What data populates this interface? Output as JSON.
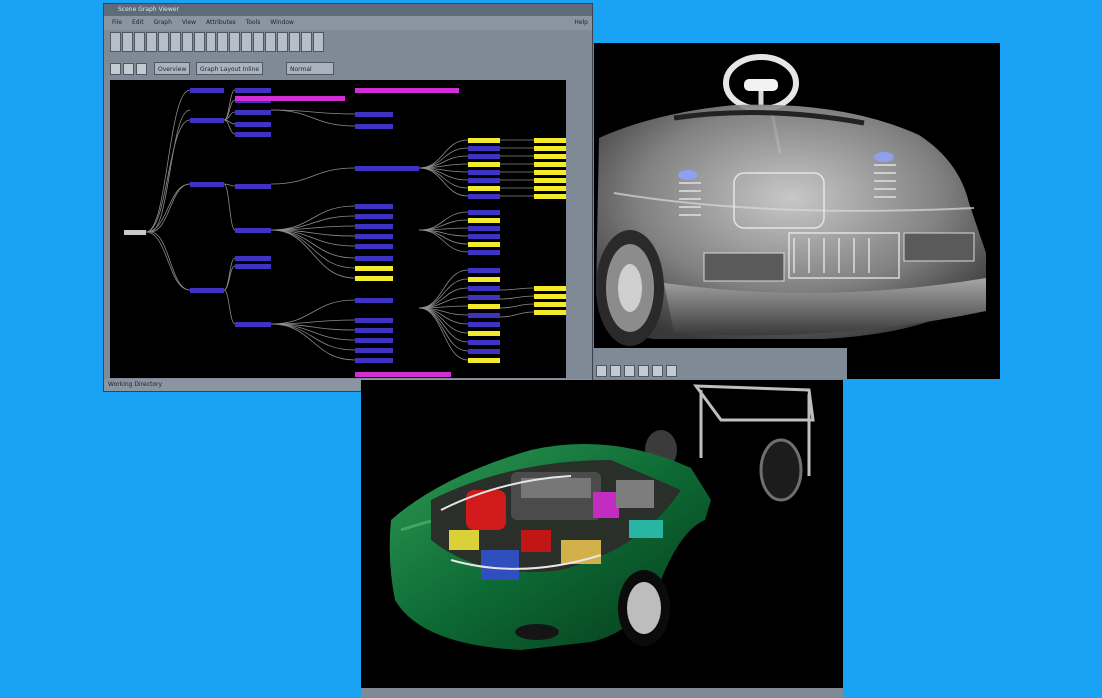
{
  "background_color": "#1aa3f5",
  "graph_window": {
    "title": "Scene Graph Viewer",
    "menu": [
      "File",
      "Edit",
      "Graph",
      "View",
      "Attributes",
      "Tools",
      "Window"
    ],
    "help": "Help",
    "view_tab": "Overview",
    "view_label": "Graph Layout Inline",
    "view_select": "Normal",
    "status": "Working Directory",
    "toolbar_icons": [
      "open-icon",
      "save-icon",
      "print-icon",
      "cut-icon",
      "copy-icon",
      "paste-icon",
      "select-icon",
      "pan-icon",
      "zoom-icon",
      "fit-icon",
      "expand-icon",
      "collapse-icon",
      "group-icon",
      "link-icon",
      "layout-icon",
      "refresh-icon",
      "settings-icon",
      "info-icon"
    ],
    "node_colors": {
      "blue": "#3f33c4",
      "yellow": "#f2ea2a",
      "magenta": "#d12fd3",
      "edge": "#8c8c8c"
    }
  },
  "xray_viewer": {
    "toolbar_icons": [
      "home-icon",
      "rotate-icon",
      "pan-icon",
      "zoom-icon",
      "fit-icon",
      "look-icon"
    ]
  },
  "car_viewer": {
    "body_color": "#0d6a34"
  }
}
